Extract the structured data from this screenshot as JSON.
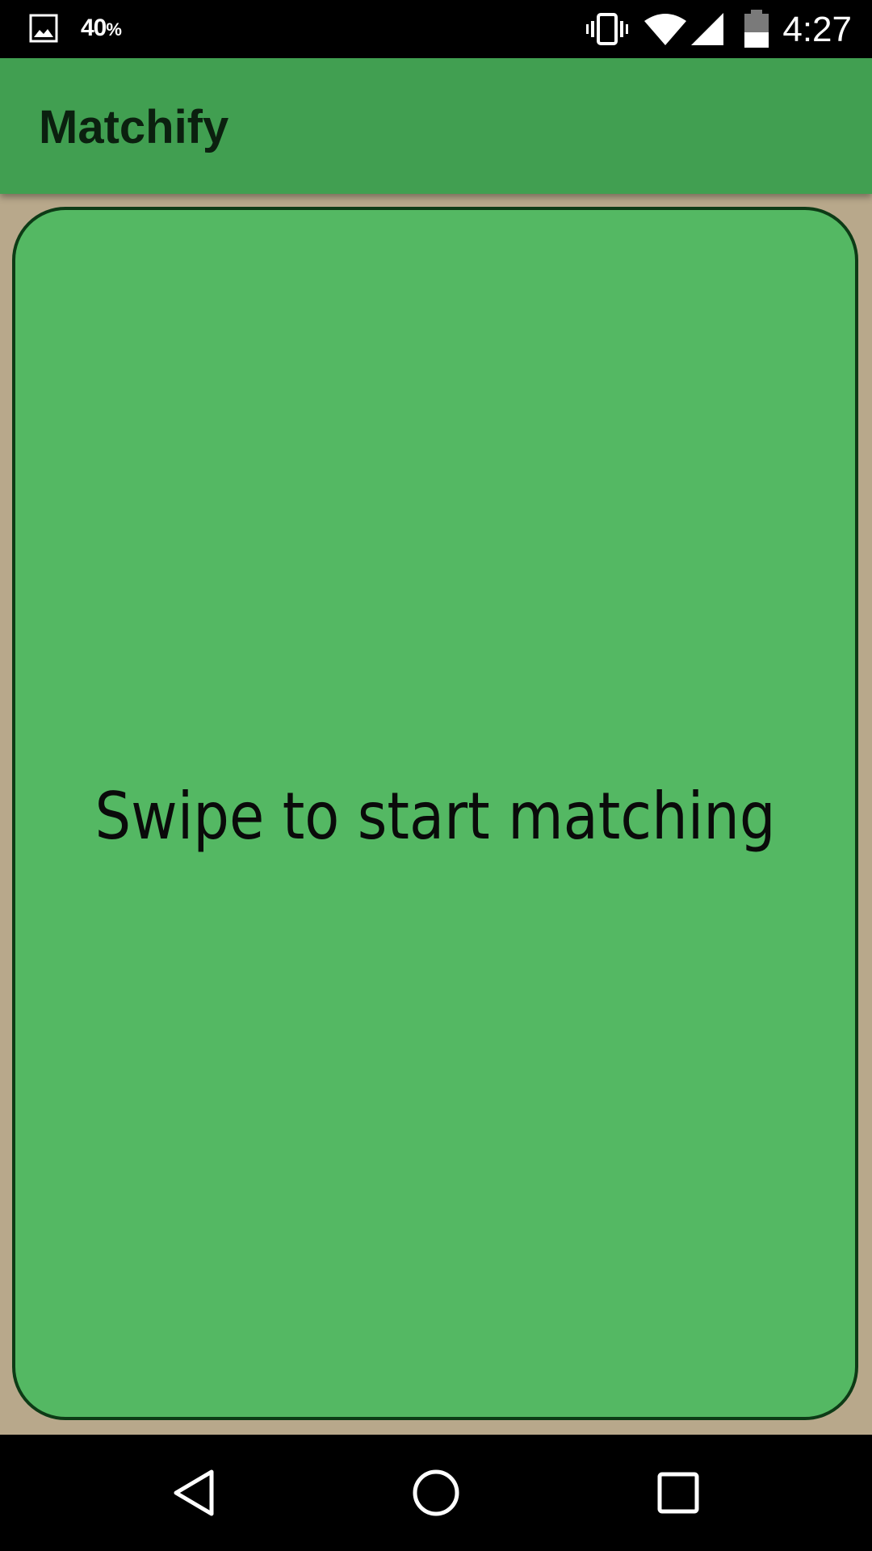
{
  "status_bar": {
    "notification_icon": "image-icon",
    "battery_percent_number": "40",
    "battery_percent_sign": "%",
    "icons": [
      "vibrate-icon",
      "wifi-icon",
      "cell-signal-icon",
      "battery-icon"
    ],
    "time": "4:27"
  },
  "app_bar": {
    "title": "Matchify",
    "color": "#419f51"
  },
  "card": {
    "message": "Swipe to start matching",
    "background_color": "#54b863",
    "border_color": "#0d3b16"
  },
  "screen": {
    "background_color": "#b8a88b"
  },
  "nav_bar": {
    "buttons": [
      "back-icon",
      "home-icon",
      "recents-icon"
    ]
  }
}
